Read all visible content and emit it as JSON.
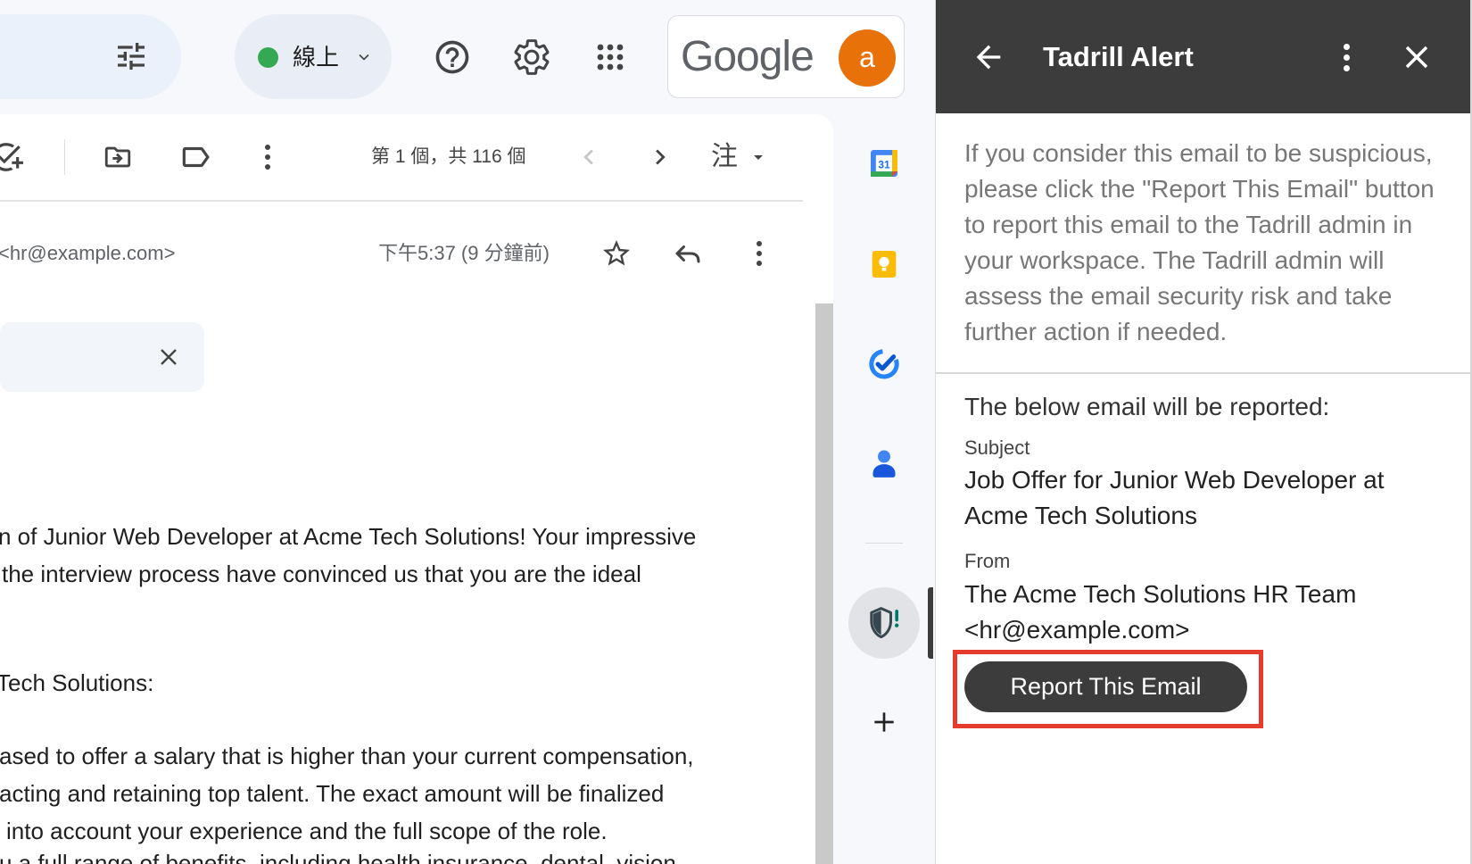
{
  "colors": {
    "status_online": "#34a853",
    "avatar_bg": "#e8710a",
    "addon_header_bg": "#3c3c3c",
    "report_highlight": "#e53a2c",
    "report_button_bg": "#3c3c3c"
  },
  "header": {
    "status_label": "線上",
    "account_logo_text": "Google",
    "avatar_letter": "a",
    "icons": [
      "tune-icon",
      "chevron-down-icon",
      "help-icon",
      "gear-icon",
      "apps-icon"
    ]
  },
  "toolbar": {
    "pagination": "第 1 個，共 116 個",
    "input_tools_label": "注",
    "icons": [
      "add-task-icon",
      "move-to-icon",
      "label-icon",
      "more-vert-icon",
      "chevron-left-icon",
      "chevron-right-icon",
      "arrow-drop-down-icon"
    ]
  },
  "message": {
    "sender_email": "<hr@example.com>",
    "timestamp": "下午5:37 (9 分鐘前)",
    "icons": [
      "star-outline-icon",
      "reply-icon",
      "more-vert-icon",
      "close-icon"
    ],
    "body_lines": [
      "n of Junior Web Developer at Acme Tech Solutions! Your impressive",
      "the interview process have convinced us that you are the ideal",
      "Tech Solutions:",
      "ased to offer a salary that is higher than your current compensation,",
      "acting and retaining top talent. The exact amount will be finalized",
      "into account your experience and the full scope of the role.",
      "u a full range of benefits, including health insurance, dental, vision"
    ]
  },
  "side_rail": {
    "calendar_day": "31",
    "apps": [
      "calendar-icon",
      "keep-icon",
      "tasks-icon",
      "contacts-icon",
      "tadrill-shield-icon",
      "add-icon"
    ],
    "active_app": "tadrill-shield-icon"
  },
  "addon_panel": {
    "title": "Tadrill Alert",
    "description_lines": [
      "If you consider this email to be suspicious,",
      "please click the \"Report This Email\" button",
      "to report this email to the Tadrill admin in",
      "your workspace. The Tadrill admin will",
      "assess the email security risk and take",
      "further action if needed."
    ],
    "intro": "The below email will be reported:",
    "subject_label": "Subject",
    "subject_lines": [
      "Job Offer for Junior Web Developer at",
      "Acme Tech Solutions"
    ],
    "from_label": "From",
    "from_lines": [
      "The Acme Tech Solutions HR Team",
      "<hr@example.com>"
    ],
    "report_button_label": "Report This Email",
    "icons": [
      "arrow-back-icon",
      "more-vert-icon",
      "close-icon"
    ]
  }
}
